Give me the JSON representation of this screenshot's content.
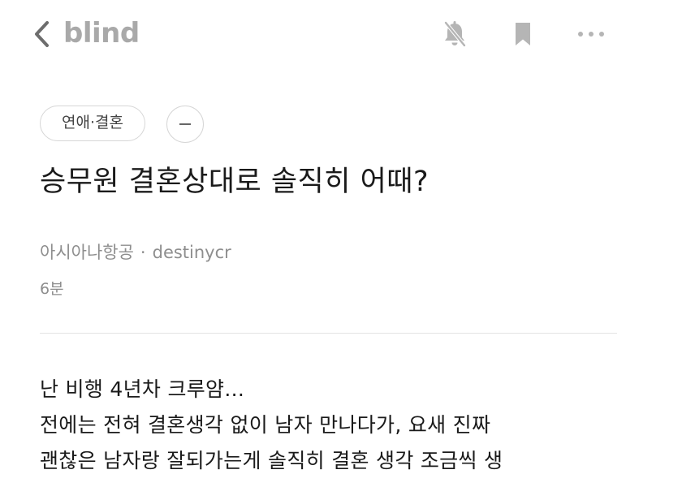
{
  "header": {
    "logo": "blind",
    "icons": {
      "back": "chevron-left-icon",
      "notification": "bell-off-icon",
      "bookmark": "bookmark-icon",
      "more": "more-icon"
    }
  },
  "post": {
    "category": "연애·결혼",
    "category_toggle": "–",
    "title": "승무원 결혼상대로 솔직히 어때?",
    "company": "아시아나항공",
    "separator": "·",
    "author": "destinycr",
    "time": "6분",
    "body_lines": [
      "난 비행 4년차 크루얌...",
      "전에는 전혀 결혼생각 없이 남자 만나다가, 요새 진짜",
      "괜찮은 남자랑 잘되가는게 솔직히 결혼 생각 조금씩 생"
    ]
  },
  "colors": {
    "logo": "#a9a9a9",
    "icon": "#b5b5b5",
    "meta": "#8e8e8e",
    "border": "#d6d6d6"
  }
}
